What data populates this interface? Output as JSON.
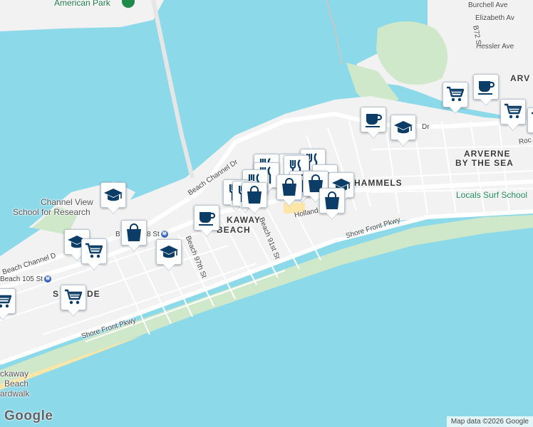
{
  "map": {
    "labels": {
      "american_park": "American Park",
      "burchell_ave": "Burchell Ave",
      "elizabeth_ave": "Elizabeth Av",
      "hessler_ave": "Hessler Ave",
      "b72_st": "B72 St",
      "arverne_partial": "ARV",
      "dr_partial": "Dr",
      "beach_channel_dr": "Beach Channel Dr",
      "arverne_by_the_sea_1": "ARVERNE",
      "arverne_by_the_sea_2": "BY THE SEA",
      "roc_partial": "Roc",
      "hammels": "HAMMELS",
      "locals_surf_school": "Locals Surf School",
      "channel_view_1": "Channel View",
      "channel_view_2": "School for Research",
      "rockaway_beach_1": "KAWAY",
      "rockaway_beach_2": "BEACH",
      "holland": "Holland",
      "beach_91st_st": "Beach 91st St",
      "beach_97th_st": "Beach 97th St",
      "shore_front_pkwy_east": "Shore Front Pkwy",
      "beach_98_st": "B",
      "beach_98_st_suffix": "8 St",
      "beach_channel_dr_west": "Beach Channel D",
      "beach_105_st": "Beach 105 St",
      "seaside_partial_1": "S",
      "seaside_partial_2": "DE",
      "shore_front_pkwy_west": "Shore Front Pkwy",
      "rockaway_beach_boardwalk_1": "ckaway",
      "rockaway_beach_boardwalk_2": "Beach",
      "rockaway_beach_boardwalk_3": "ardwalk",
      "subway_symbol": "M"
    },
    "markers": [
      {
        "id": "shopping-cart-1",
        "icon": "shopping-cart-icon"
      },
      {
        "id": "coffee-1",
        "icon": "coffee-cup-icon"
      },
      {
        "id": "shopping-cart-2",
        "icon": "shopping-cart-icon"
      },
      {
        "id": "coffee-2",
        "icon": "coffee-cup-icon"
      },
      {
        "id": "school-1",
        "icon": "school-icon"
      },
      {
        "id": "restaurant-1",
        "icon": "fork-knife-icon"
      },
      {
        "id": "restaurant-2",
        "icon": "fork-knife-icon"
      },
      {
        "id": "restaurant-3",
        "icon": "fork-knife-icon"
      },
      {
        "id": "restaurant-4",
        "icon": "fork-knife-icon"
      },
      {
        "id": "restaurant-5",
        "icon": "fork-knife-icon"
      },
      {
        "id": "bag-1",
        "icon": "shopping-bag-icon"
      },
      {
        "id": "bag-2",
        "icon": "shopping-bag-icon"
      },
      {
        "id": "school-2",
        "icon": "school-icon"
      },
      {
        "id": "restaurant-6",
        "icon": "fork-knife-icon"
      },
      {
        "id": "restaurant-7",
        "icon": "fork-knife-icon"
      },
      {
        "id": "bag-3",
        "icon": "shopping-bag-icon"
      },
      {
        "id": "bag-4",
        "icon": "shopping-bag-icon"
      },
      {
        "id": "coffee-3",
        "icon": "coffee-cup-icon"
      },
      {
        "id": "school-3",
        "icon": "school-icon"
      },
      {
        "id": "bag-5",
        "icon": "shopping-bag-icon"
      },
      {
        "id": "school-4",
        "icon": "school-icon"
      },
      {
        "id": "shopping-cart-3",
        "icon": "shopping-cart-icon"
      },
      {
        "id": "school-5",
        "icon": "school-icon"
      },
      {
        "id": "shopping-cart-4",
        "icon": "shopping-cart-icon"
      },
      {
        "id": "shopping-cart-5",
        "icon": "shopping-cart-icon"
      }
    ],
    "colors": {
      "water": "#8cd9ea",
      "land": "#f2f2f2",
      "park": "#cfe8c9",
      "beach": "#fbe6a8",
      "road": "#ffffff",
      "marker_icon": "#0b3d66"
    }
  },
  "branding": {
    "logo": "Google"
  },
  "attribution": {
    "text": "Map data ©2026 Google"
  }
}
